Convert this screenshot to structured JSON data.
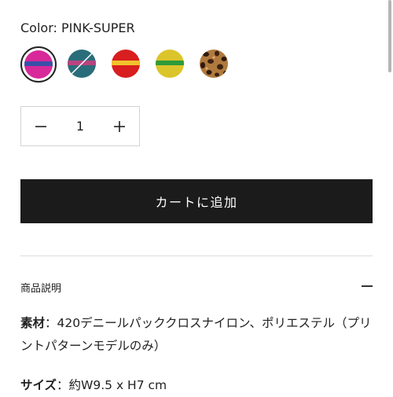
{
  "color_selector": {
    "label": "Color: PINK-SUPER",
    "swatches": [
      {
        "name": "PINK-SUPER",
        "selected": true
      },
      {
        "name": "teal",
        "selected": false,
        "sold_out": true
      },
      {
        "name": "red",
        "selected": false
      },
      {
        "name": "yellow",
        "selected": false
      },
      {
        "name": "leopard",
        "selected": false
      }
    ]
  },
  "quantity": {
    "value": "1",
    "minus_icon": "minus-icon",
    "plus_icon": "plus-icon"
  },
  "cart_button": {
    "label": "カートに追加"
  },
  "description": {
    "title": "商品説明",
    "toggle_icon": "minus-icon",
    "material_label": "素材",
    "material_value": "：420デニールパッククロスナイロン、ポリエステル（プリントパターンモデルのみ）",
    "size_label": "サイズ",
    "size_value": "：約W9.5 x H7 cm"
  },
  "colors": {
    "button_bg": "#1b1b1b",
    "text": "#222222",
    "border": "#d4d4d4"
  }
}
